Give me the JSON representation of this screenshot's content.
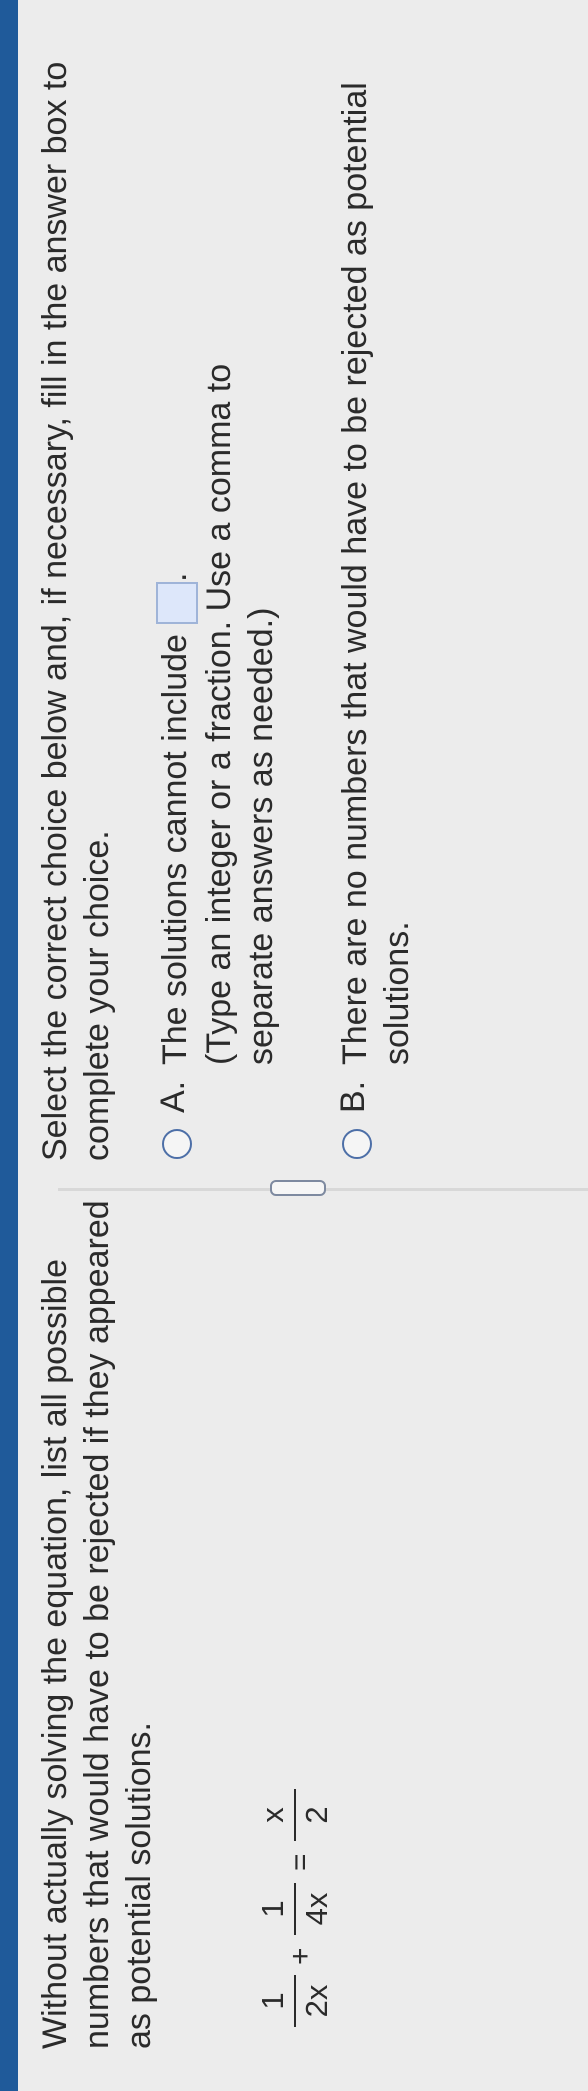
{
  "question": {
    "text": "Without actually solving the equation, list all possible numbers that would have to be rejected if they appeared as potential solutions."
  },
  "equation": {
    "term1": {
      "num": "1",
      "den": "2x"
    },
    "op1": "+",
    "term2": {
      "num": "1",
      "den": "4x"
    },
    "eq": "=",
    "term3": {
      "num": "x",
      "den": "2"
    }
  },
  "instruction": "Select the correct choice below and, if necessary, fill in the answer box to complete your choice.",
  "choices": [
    {
      "letter": "A.",
      "text": "The solutions cannot include",
      "after": ".",
      "note": "(Type an integer or a fraction. Use a comma to separate answers as needed.)"
    },
    {
      "letter": "B.",
      "text": "There are no numbers that would have to be rejected as potential solutions."
    }
  ],
  "colors": {
    "top_bar": "#1f5a9a",
    "radio": "#4d6fa7",
    "answer_box": "#dde7fa"
  }
}
